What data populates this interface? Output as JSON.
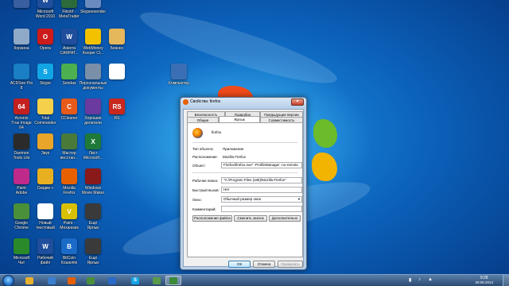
{
  "desktop": {
    "icons": [
      {
        "label": "",
        "glyph": "",
        "color": "#3a5fa0",
        "icon": "blank-app-icon"
      },
      {
        "label": "Microsoft\nWord 2010",
        "glyph": "W",
        "color": "#1f4e9c",
        "icon": "word-icon"
      },
      {
        "label": "Fibotrf -\nMetaTrader",
        "glyph": "",
        "color": "#2c6a3a",
        "icon": "metatrader-icon"
      },
      {
        "label": "Skypeesender",
        "glyph": "",
        "color": "#6a8bbf",
        "icon": "app-icon"
      },
      {
        "label": "Корзина",
        "glyph": "",
        "color": "#8fa9c9",
        "icon": "recycle-bin-icon"
      },
      {
        "label": "Opera",
        "glyph": "O",
        "color": "#cc1b1b",
        "icon": "opera-icon"
      },
      {
        "label": "Анкета\nCARPAT...",
        "glyph": "W",
        "color": "#1f4e9c",
        "icon": "word-doc-icon"
      },
      {
        "label": "WebMoney\nKeeper Cl...",
        "glyph": "",
        "color": "#f2c200",
        "icon": "webmoney-icon"
      },
      {
        "label": "Бизнес",
        "glyph": "",
        "color": "#e6b85c",
        "icon": "folder-icon"
      },
      {
        "label": "ACDSee Pro\n8",
        "glyph": "",
        "color": "#1a7fc4",
        "icon": "acdsee-icon"
      },
      {
        "label": "Skype",
        "glyph": "S",
        "color": "#12a5e6",
        "icon": "skype-icon"
      },
      {
        "label": "Sendas",
        "glyph": "",
        "color": "#4caf50",
        "icon": "sendas-icon"
      },
      {
        "label": "Персональные\nдокументы",
        "glyph": "",
        "color": "#7a8fa8",
        "icon": "documents-icon"
      },
      {
        "label": "",
        "glyph": "",
        "color": "#ffffff",
        "icon": "blank-doc-icon"
      },
      {
        "label": "Компьютер",
        "glyph": "",
        "color": "#3b6fb5",
        "icon": "computer-icon"
      },
      {
        "label": "Acronis\nTrue Image\n64",
        "glyph": "64",
        "color": "#c42020",
        "icon": "acronis-icon"
      },
      {
        "label": "Total\nCommander",
        "glyph": "",
        "color": "#f5d04a",
        "icon": "total-commander-icon"
      },
      {
        "label": "CCleaner",
        "glyph": "C",
        "color": "#e85a1a",
        "icon": "ccleaner-icon"
      },
      {
        "label": "Хорошие\nделатели",
        "glyph": "",
        "color": "#6a3aa0",
        "icon": "winrar-icon"
      },
      {
        "label": "RS",
        "glyph": "RS",
        "color": "#c8281e",
        "icon": "rs-icon"
      },
      {
        "label": "Daemon\nTools Lite",
        "glyph": "",
        "color": "#2b2b2b",
        "icon": "daemon-tools-icon"
      },
      {
        "label": "Звук",
        "glyph": "",
        "color": "#e8a52a",
        "icon": "sound-icon"
      },
      {
        "label": "Мастер\nвосстан...",
        "glyph": "",
        "color": "#4a7a3a",
        "icon": "recovery-icon"
      },
      {
        "label": "Лист\nMicrosoft...",
        "glyph": "X",
        "color": "#1f7a3a",
        "icon": "excel-icon"
      },
      {
        "label": "Paint\nAdobe",
        "glyph": "",
        "color": "#c02a8a",
        "icon": "paint-icon"
      },
      {
        "label": "Скидки +",
        "glyph": "",
        "color": "#e8b020",
        "icon": "discount-icon"
      },
      {
        "label": "Mozilla\nFirefox",
        "glyph": "",
        "color": "#e66000",
        "icon": "firefox-icon"
      },
      {
        "label": "Windows\nMovie Maker",
        "glyph": "",
        "color": "#8a1a1a",
        "icon": "movie-maker-icon"
      },
      {
        "label": "Google\nChrome",
        "glyph": "",
        "color": "#4a8f3a",
        "icon": "chrome-icon"
      },
      {
        "label": "Новый\nтекстовый",
        "glyph": "",
        "color": "#ffffff",
        "icon": "text-file-icon"
      },
      {
        "label": "Paint -\nМеханизм",
        "glyph": "V",
        "color": "#d8c000",
        "icon": "vector-icon"
      },
      {
        "label": "Ещё\nЯрлык",
        "glyph": "",
        "color": "#3a3a3a",
        "icon": "shortcut-icon"
      },
      {
        "label": "Microsoft\nЧат",
        "glyph": "",
        "color": "#2a8a2a",
        "icon": "chat-icon"
      },
      {
        "label": "Рабочий\nфайл",
        "glyph": "W",
        "color": "#1f4e9c",
        "icon": "word-file-icon"
      },
      {
        "label": "BitCoin\nКошелёк",
        "glyph": "B",
        "color": "#1a6ac8",
        "icon": "bitcoin-icon"
      },
      {
        "label": "Ещё\nЯрлык",
        "glyph": "",
        "color": "#3a3a3a",
        "icon": "shortcut-icon"
      }
    ]
  },
  "dialog": {
    "title": "Свойства: firefox",
    "close_glyph": "×",
    "tabs_row1": [
      "Безопасность",
      "Подробно",
      "Предыдущие версии"
    ],
    "tabs_row2": [
      "Общие",
      "Ярлык",
      "Совместимость"
    ],
    "app_name": "firefox",
    "rows": {
      "type_label": "Тип объекта:",
      "type_value": "Приложение",
      "location_label": "Расположение:",
      "location_value": "Mozilla Firefox",
      "target_label": "Объект:",
      "target_value": "Firefox\\firefox.exe\" -ProfileManager -no-remote",
      "workdir_label": "Рабочая папка:",
      "workdir_value": "\"C:\\Program Files (x86)\\Mozilla Firefox\"",
      "hotkey_label": "Быстрый вызов:",
      "hotkey_value": "Нет",
      "window_label": "Окно:",
      "window_value": "Обычный размер окна",
      "comment_label": "Комментарий:",
      "comment_value": ""
    },
    "panel_buttons": [
      "Расположение файла",
      "Сменить значок",
      "Дополнительно"
    ],
    "footer_buttons": [
      "ОК",
      "Отмена",
      "Применить"
    ]
  },
  "taskbar": {
    "start": "",
    "clock_time": "9:28",
    "clock_date": "29.08.2014",
    "buttons": [
      {
        "glyph": "",
        "color": "#e8b030",
        "icon": "explorer-icon"
      },
      {
        "glyph": "",
        "color": "#3a7fd0",
        "icon": "media-player-icon"
      },
      {
        "glyph": "",
        "color": "#e66000",
        "icon": "firefox-icon"
      },
      {
        "glyph": "",
        "color": "#4a8f3a",
        "icon": "chrome-icon"
      },
      {
        "glyph": "",
        "color": "#2a6ac8",
        "icon": "window-icon"
      },
      {
        "glyph": "S",
        "color": "#12a5e6",
        "icon": "skype-icon"
      },
      {
        "glyph": "",
        "color": "#5a9a4a",
        "icon": "app-icon"
      },
      {
        "glyph": "",
        "color": "#3a8a3a",
        "icon": "active-app-icon"
      }
    ]
  }
}
